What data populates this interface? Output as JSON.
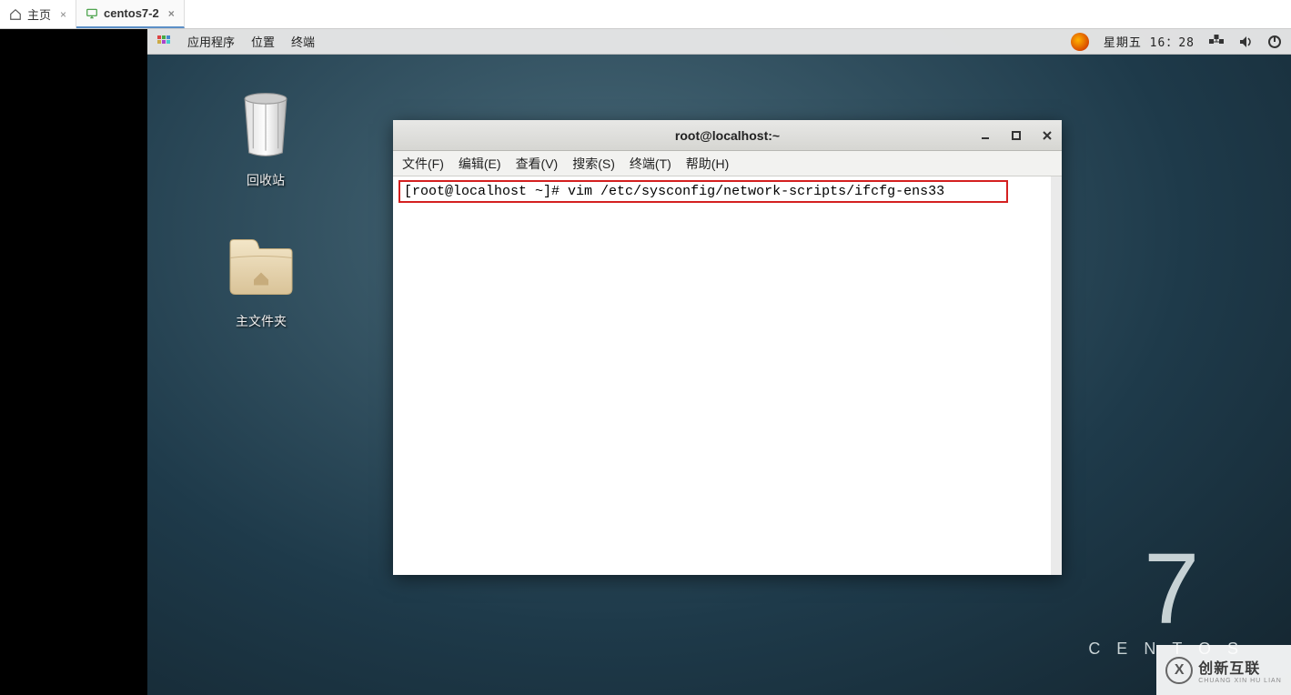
{
  "vm_tabs": {
    "home_label": "主页",
    "vm_label": "centos7-2"
  },
  "gnome": {
    "apps": "应用程序",
    "places": "位置",
    "terminal": "终端",
    "clock": "星期五 16：28"
  },
  "desktop_icons": {
    "trash": "回收站",
    "home": "主文件夹"
  },
  "terminal": {
    "title": "root@localhost:~",
    "menu": {
      "file": "文件(F)",
      "edit": "编辑(E)",
      "view": "查看(V)",
      "search": "搜索(S)",
      "terminal": "终端(T)",
      "help": "帮助(H)"
    },
    "prompt": "[root@localhost ~]#",
    "command": "vim /etc/sysconfig/network-scripts/ifcfg-ens33"
  },
  "brand": {
    "num": "7",
    "name": "CENTOS"
  },
  "watermark": {
    "main": "创新互联",
    "sub": "CHUANG XIN HU LIAN"
  }
}
